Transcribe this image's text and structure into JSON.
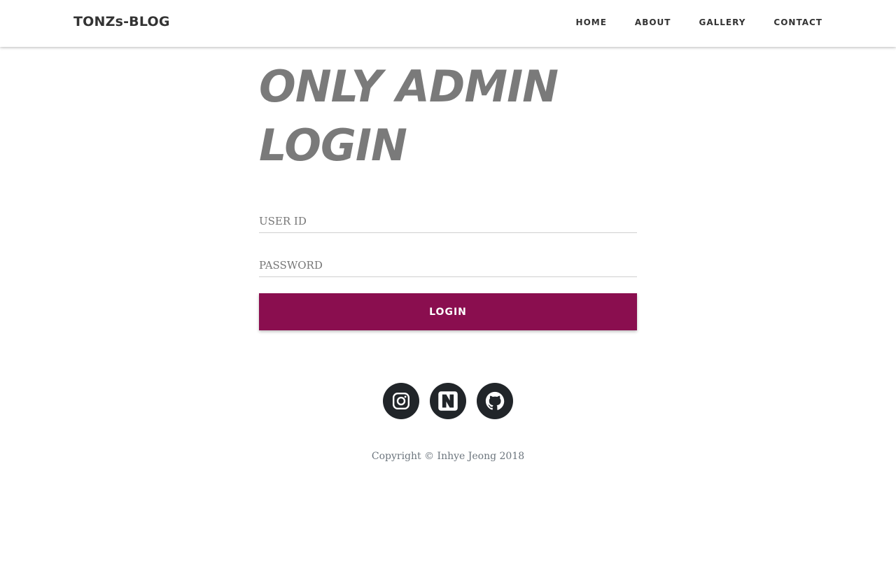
{
  "navbar": {
    "brand": "TONZs-BLOG",
    "links": [
      "HOME",
      "ABOUT",
      "GALLERY",
      "CONTACT"
    ]
  },
  "main": {
    "title_line1": "ONLY ADMIN",
    "title_line2": "LOGIN",
    "user_id_placeholder": "USER ID",
    "user_id_value": "",
    "password_placeholder": "PASSWORD",
    "password_value": "",
    "login_label": "LOGIN"
  },
  "footer": {
    "socials": [
      {
        "icon": "instagram-icon"
      },
      {
        "icon": "naver-icon"
      },
      {
        "icon": "github-icon"
      }
    ],
    "copyright": "Copyright © Inhye Jeong 2018"
  },
  "colors": {
    "accent": "#8a0e4f",
    "title": "#7a7a7a",
    "social_bg": "#212529",
    "text_muted": "#6c757d"
  }
}
